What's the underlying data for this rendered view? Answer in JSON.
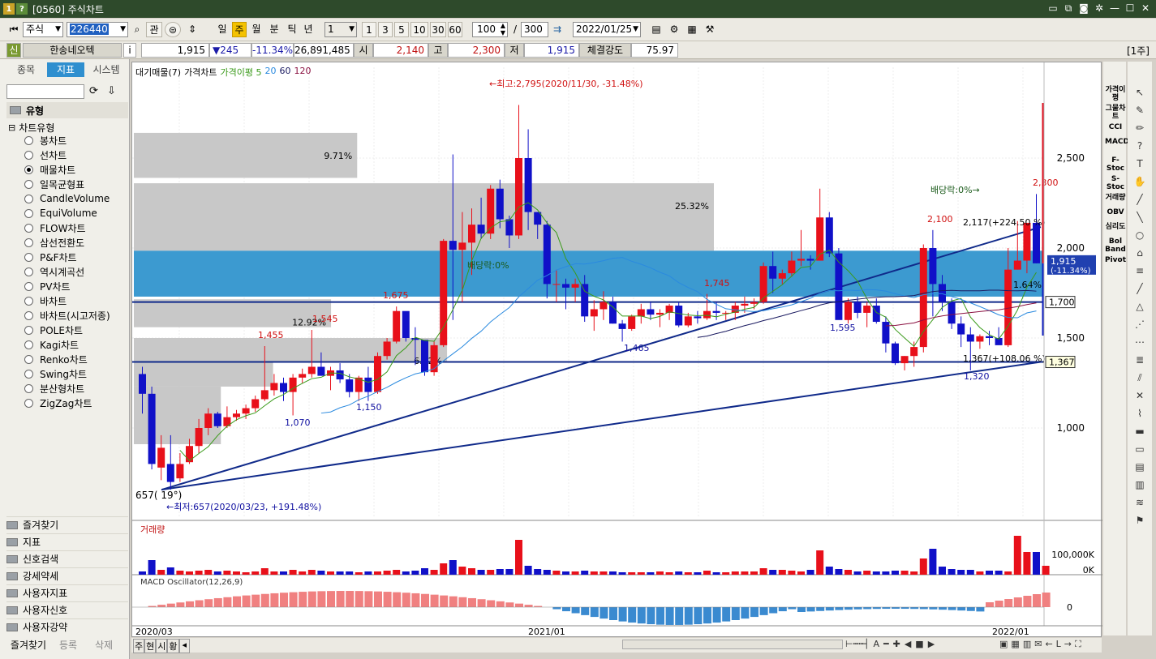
{
  "window": {
    "title": "[0560] 주식차트",
    "icon_a": "1",
    "icon_b": "?"
  },
  "toolbar": {
    "market": "주식",
    "code": "226440",
    "btn_gwan": "관",
    "periods": [
      "일",
      "주",
      "월",
      "분",
      "틱",
      "년"
    ],
    "active_period": "주",
    "count_value": "1",
    "quick_counts": [
      "1",
      "3",
      "5",
      "10",
      "30",
      "60"
    ],
    "display_count": "100",
    "slash": "/",
    "total_count": "300",
    "date": "2022/01/25"
  },
  "quote": {
    "badge": "신",
    "name": "한송네오텍",
    "info": "i",
    "price": "1,915",
    "change": "▼245",
    "rate": "-11.34%",
    "volume": "26,891,485",
    "open_label": "시",
    "open": "2,140",
    "high_label": "고",
    "high": "2,300",
    "low_label": "저",
    "low": "1,915",
    "strength_label": "체결강도",
    "strength": "75.97",
    "unit": "[1주]"
  },
  "left_panel": {
    "tabs": [
      "종목",
      "지표",
      "시스템"
    ],
    "active_tab": "지표",
    "section": "유형",
    "category": "차트유형",
    "chart_types": [
      "봉차트",
      "선차트",
      "매물차트",
      "일목균형표",
      "CandleVolume",
      "EquiVolume",
      "FLOW차트",
      "삼선전환도",
      "P&F차트",
      "역시계곡선",
      "PV차트",
      "바차트",
      "바차트(시고저종)",
      "POLE차트",
      "Kagi차트",
      "Renko차트",
      "Swing차트",
      "분산형차트",
      "ZigZag차트"
    ],
    "selected_type": "매물차트",
    "folders": [
      "즐겨찾기",
      "지표",
      "신호검색",
      "강세약세",
      "사용자지표",
      "사용자신호",
      "사용자강약"
    ],
    "bottom_buttons": [
      "즐겨찾기",
      "등록",
      "삭제"
    ]
  },
  "chart_data": {
    "type": "candlestick",
    "legend": [
      "대기매물(7)",
      "가격차트",
      "가격이평 5",
      "20",
      "60",
      "120"
    ],
    "colors": {
      "up": "#e8101a",
      "down": "#1010c8",
      "ma5": "#3a9a1a",
      "ma20": "#2a8adf",
      "ma60": "#1a1a60",
      "ma120": "#8a1040",
      "box": "#c8c8c8",
      "box_hl": "#3c9ad0"
    },
    "y_ticks": [
      "2,500",
      "2,000",
      "1,500",
      "1,000"
    ],
    "x_labels": [
      "2020/03",
      "2021/01",
      "2022/01"
    ],
    "price_annotations": {
      "high_note": "←최고:2,795(2020/11/30, -31.48%)",
      "low_note": "←최저:657(2020/03/23, +191.48%)",
      "low_label": "657( 19°)",
      "dividend1": "배당락:0%",
      "dividend2": "배당락:0%→",
      "trend_right": "2,117(+224.50 %)",
      "trend_bottom": "1,367(+108.06 %)"
    },
    "volume_profile": [
      "9.71%",
      "25.32%",
      "12.92%",
      "6.22%",
      "1.64%"
    ],
    "peak_labels": [
      {
        "text": "1,455",
        "color": "red"
      },
      {
        "text": "1,545",
        "color": "red"
      },
      {
        "text": "1,675",
        "color": "red"
      },
      {
        "text": "1,745",
        "color": "red"
      },
      {
        "text": "2,100",
        "color": "red"
      },
      {
        "text": "2,300",
        "color": "red"
      },
      {
        "text": "1,070",
        "color": "blue"
      },
      {
        "text": "1,150",
        "color": "blue"
      },
      {
        "text": "1,465",
        "color": "blue"
      },
      {
        "text": "1,595",
        "color": "blue"
      },
      {
        "text": "1,320",
        "color": "blue"
      }
    ],
    "right_tags": {
      "current": "1,915",
      "current_rate": "(-11.34%)",
      "level1": "1,700",
      "level2": "1,367"
    },
    "volume_title": "거래량",
    "volume_ticks": [
      "100,000K",
      "0K"
    ],
    "macd_title": "MACD Oscillator(12,26,9)",
    "macd_ticks": [
      "0"
    ]
  },
  "right_indicators": [
    "가격이평",
    "그물차트",
    "CCI",
    "MACD",
    "F-Stoc",
    "S-Stoc",
    "거래량",
    "OBV",
    "심리도",
    "Bol Band",
    "Pivot"
  ],
  "bottom_nav": [
    "주",
    "현",
    "시",
    "황"
  ]
}
